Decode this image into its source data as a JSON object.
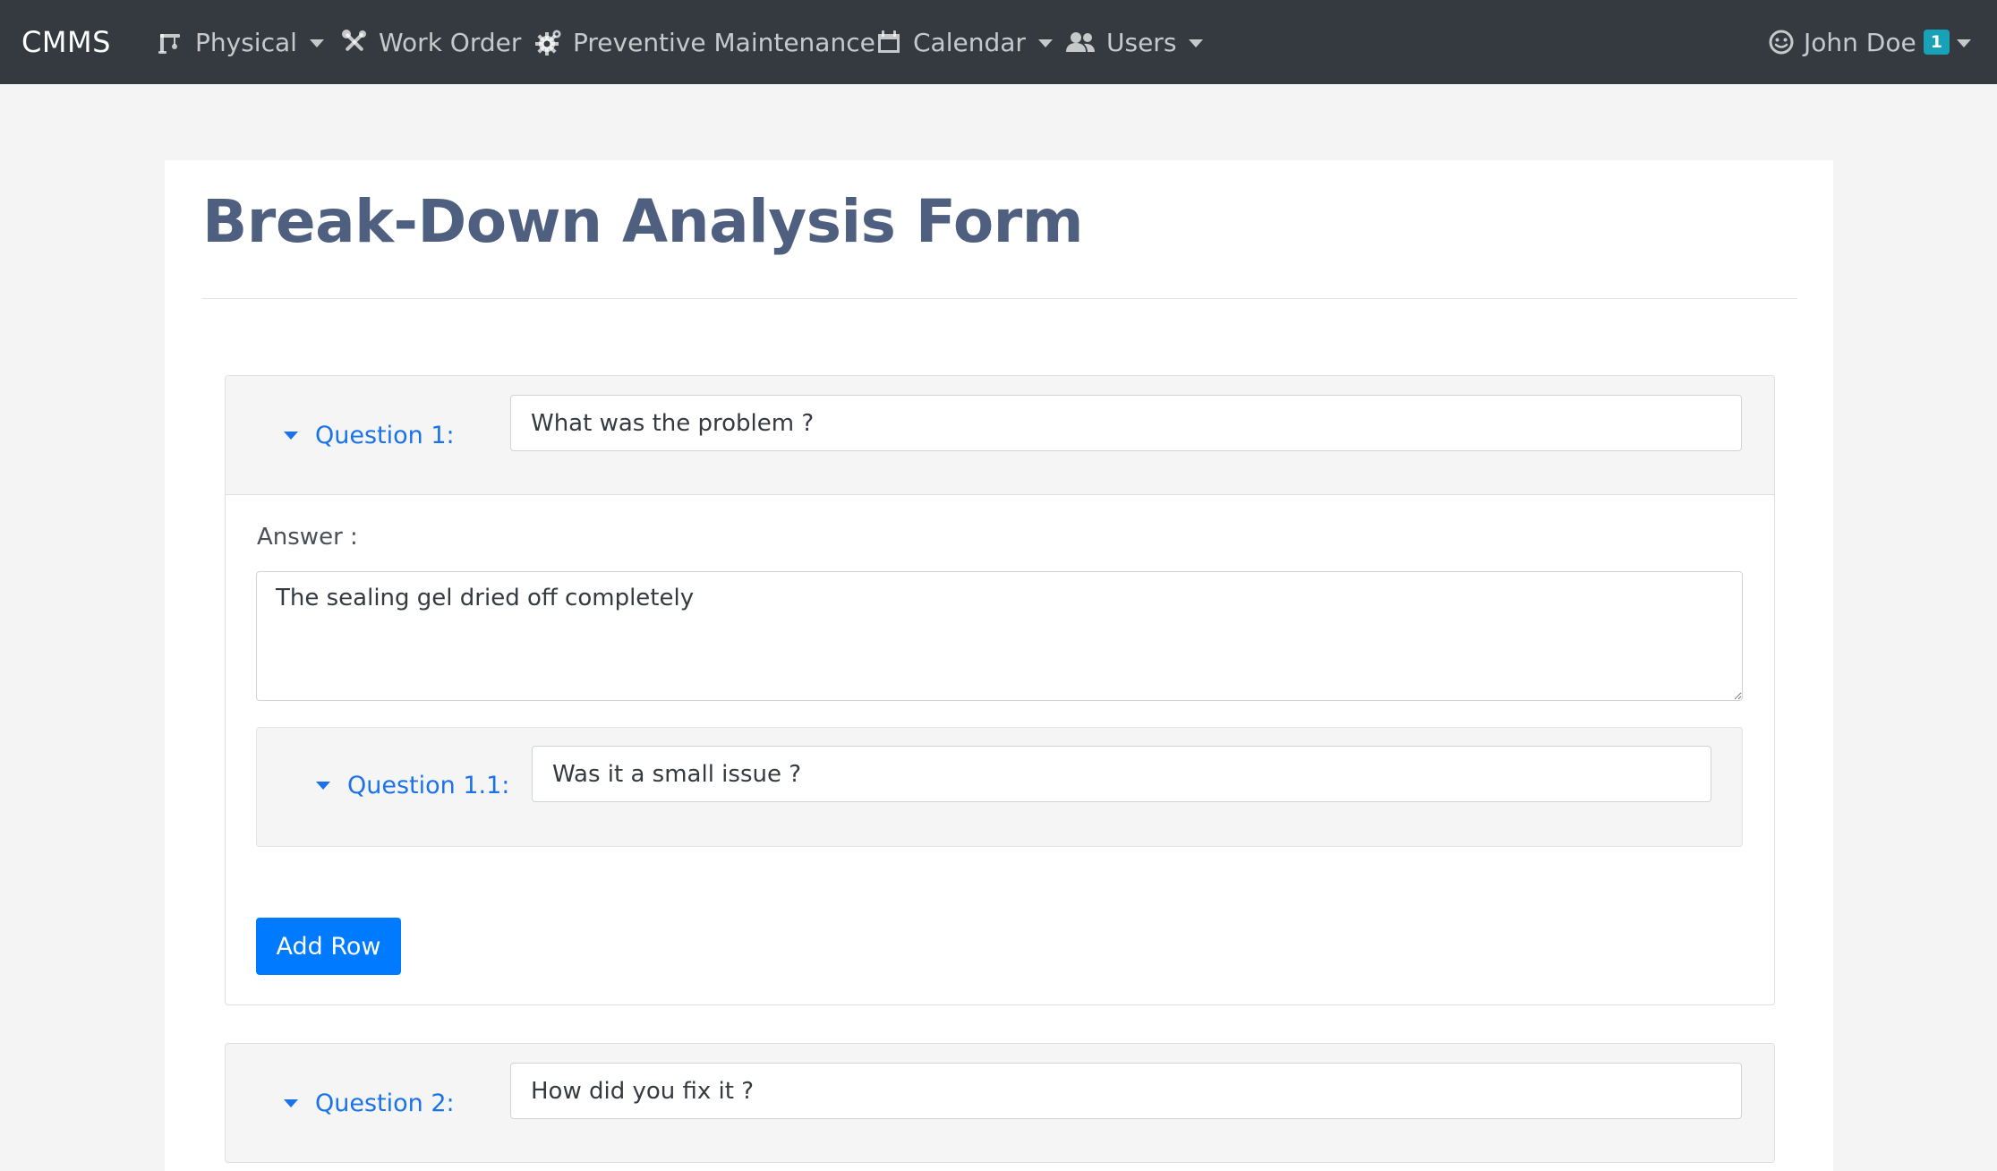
{
  "navbar": {
    "brand": "CMMS",
    "items": [
      {
        "label": "Physical",
        "icon": "crane-icon",
        "dropdown": true
      },
      {
        "label": "Work Order",
        "icon": "tools-icon",
        "dropdown": false
      },
      {
        "label": "Preventive Maintenance",
        "icon": "gear-icon",
        "dropdown": false
      },
      {
        "label": "Calendar",
        "icon": "calendar-icon",
        "dropdown": true
      },
      {
        "label": "Users",
        "icon": "users-icon",
        "dropdown": true
      }
    ],
    "user": {
      "name": "John Doe",
      "icon": "smiley-icon",
      "badge": "1"
    }
  },
  "page": {
    "title": "Break-Down Analysis Form"
  },
  "questions": [
    {
      "label": "Question 1:",
      "value": "What was the problem ?",
      "answer_label": "Answer :",
      "answer": "The sealing gel dried off completely",
      "sub_question": {
        "label": "Question 1.1:",
        "value": "Was it a small issue ?"
      },
      "add_row_label": "Add Row"
    },
    {
      "label": "Question 2:",
      "value": "How did you fix it ?"
    }
  ],
  "colors": {
    "navbar_bg": "#343a40",
    "title": "#4e5f80",
    "link": "#1a73e8",
    "primary": "#007bff",
    "badge": "#17a2b8"
  }
}
